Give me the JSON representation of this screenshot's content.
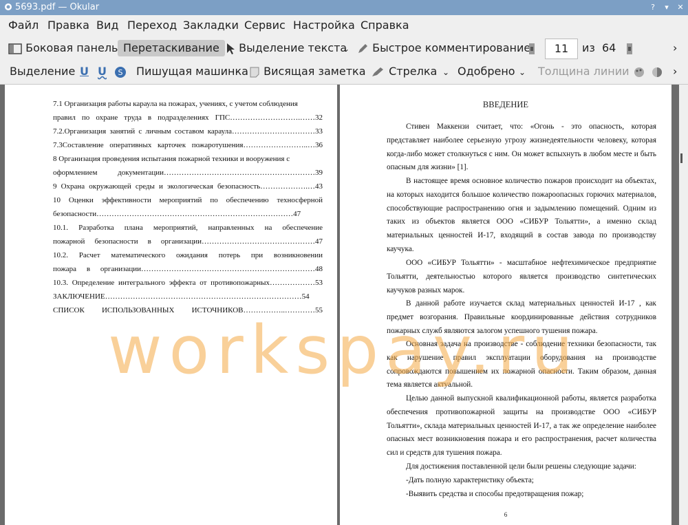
{
  "window": {
    "title": "5693.pdf — Okular"
  },
  "menu": [
    "Файл",
    "Правка",
    "Вид",
    "Переход",
    "Закладки",
    "Сервис",
    "Настройка",
    "Справка"
  ],
  "toolbar1": {
    "sidebar": "Боковая панель",
    "drag": "Перетаскивание",
    "text_select": "Выделение текста",
    "quick_comment": "Быстрое комментирование",
    "page_current": "11",
    "page_of": "из",
    "page_total": "64"
  },
  "toolbar2": {
    "highlight": "Выделение",
    "underline": "U",
    "squiggle": "U",
    "typewriter": "Пишущая машинка",
    "sticky": "Висящая заметка",
    "arrow": "Стрелка",
    "approved": "Одобрено",
    "line_width": "Толщина линии"
  },
  "left_page": {
    "lines": [
      "7.1 Организация работы караула на пожарах, учениях, с учетом соблюдения",
      "правил по охране труда в подразделениях ГПС……………………….……32",
      "7.2.Организация занятий с личным составом караула……………………………33",
      "7.3Составление оперативных карточек пожаротушения……………………..…36",
      "8 Организация проведения испытания пожарной техники и вооружения с",
      "оформлением документации……………………………………………………39",
      "9 Охрана окружающей среды и экологическая безопасность……………….…43",
      "10 Оценки эффективности мероприятий по обеспечению техносферной",
      "безопасности……………………………………………………………………47",
      "10.1. Разработка плана мероприятий, направленных на обеспечение",
      "пожарной безопасности в организации………………………………………47",
      "10.2. Расчет математического ожидания потерь при возникновении",
      "пожара в организации……………………………………………………………48",
      "10.3. Определение интегрального эффекта от противопожарных………………53",
      "ЗАКЛЮЧЕНИЕ……………………………………………………………………54",
      "СПИСОК ИСПОЛЬЗОВАННЫХ ИСТОЧНИКОВ……………..…………55"
    ]
  },
  "right_page": {
    "heading": "ВВЕДЕНИЕ",
    "paragraphs": [
      "Стивен Маккензи считает, что: «Огонь - это опасность, которая представляет наиболее серьезную угрозу жизнедеятельности человеку, которая когда-либо может столкнуться с ним. Он может вспыхнуть в любом месте и быть опасным для жизни» [1].",
      "В настоящее время основное количество пожаров происходит на объектах, на которых находится большое количество пожароопасных горючих материалов, способствующие распространению огня и задымлению помещений. Одним из таких из объектов является ООО «СИБУР Тольятти», а именно склад материальных ценностей И-17, входящий в состав завода по производству каучука.",
      "ООО «СИБУР Тольятти» - масштабное нефтехимическое предприятие Тольятти, деятельностью которого является производство синтетических каучуков разных марок.",
      "В данной работе изучается склад материальных ценностей И-17 , как предмет возгорания. Правильные координированные действия сотрудников пожарных служб являются залогом успешного тушения пожара.",
      "Основная задача на производстве - соблюдение техники безопасности, так как нарушение правил эксплуатации оборудования на производстве сопровождаются повышением их пожарной опасности. Таким образом, данная тема является актуальной.",
      "Целью данной выпускной квалификационной работы, является разработка обеспечения противопожарной защиты на производстве ООО «СИБУР Тольятти», склада материальных ценностей И-17, а так же определение наиболее опасных мест возникновения пожара и его распространения, расчет количества сил и средств для тушения пожара.",
      "Для достижения поставленной цели были решены следующие задачи:",
      "-Дать полную характеристику объекта;",
      "-Выявить средства и способы предотвращения пожар;"
    ],
    "page_number": "6"
  },
  "watermark": "workspay.ru"
}
